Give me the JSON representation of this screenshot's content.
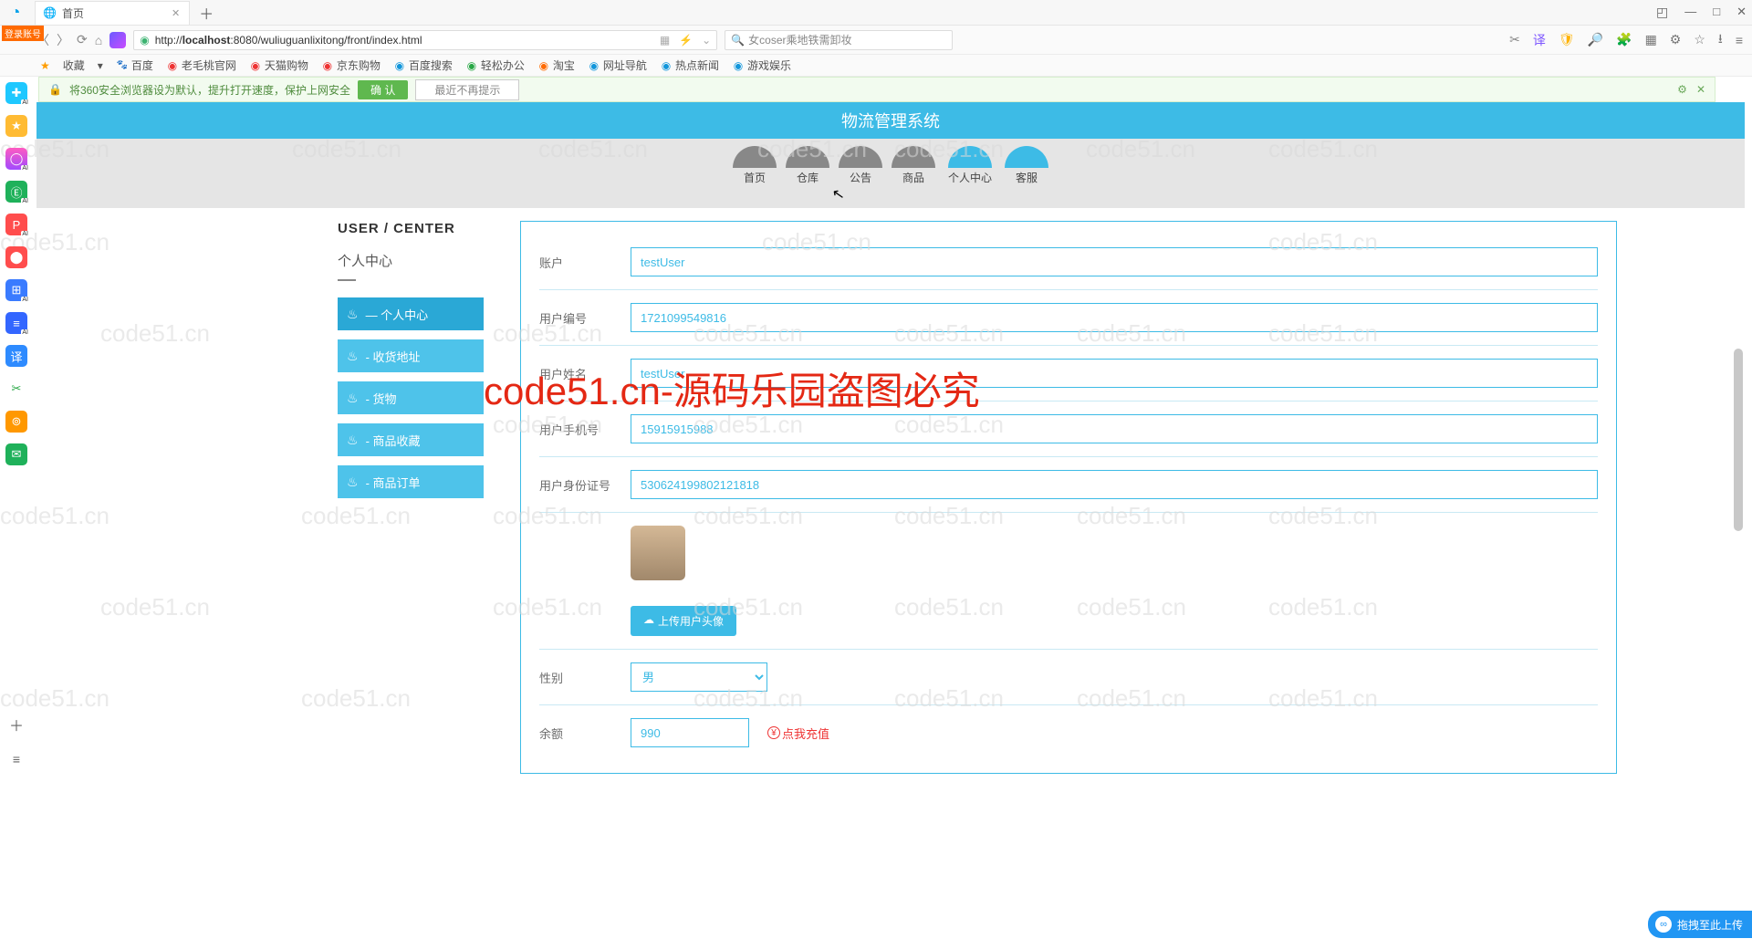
{
  "watermark": "code51.cn",
  "big_watermark": "code51.cn-源码乐园盗图必究",
  "titlebar": {
    "tab_title": "首页",
    "login_badge": "登录账号"
  },
  "winctrl": {
    "rect": "◰",
    "min": "—",
    "max": "□",
    "close": "✕"
  },
  "addr": {
    "url_prefix": "http://",
    "url_host": "localhost",
    "url_port": ":8080",
    "url_path": "/wuliuguanlixitong/front/index.html",
    "qr": "▦"
  },
  "search": {
    "placeholder": "女coser乘地铁需卸妆"
  },
  "bookmarks": {
    "fav": "收藏",
    "items": [
      "百度",
      "老毛桃官网",
      "天猫购物",
      "京东购物",
      "百度搜索",
      "轻松办公",
      "淘宝",
      "网址导航",
      "热点新闻",
      "游戏娱乐"
    ]
  },
  "infobar": {
    "text": "将360安全浏览器设为默认，提升打开速度，保护上网安全",
    "ok": "确 认",
    "no": "最近不再提示"
  },
  "page": {
    "header": "物流管理系统",
    "nav": [
      "首页",
      "仓库",
      "公告",
      "商品",
      "个人中心",
      "客服"
    ],
    "side_title": "USER / CENTER",
    "side_sub": "个人中心",
    "menu": [
      "— 个人中心",
      "- 收货地址",
      "- 货物",
      "- 商品收藏",
      "- 商品订单"
    ],
    "form": {
      "account_label": "账户",
      "account": "testUser",
      "userno_label": "用户编号",
      "userno": "1721099549816",
      "name_label": "用户姓名",
      "name": "testUser",
      "phone_label": "用户手机号",
      "phone": "15915915988",
      "idcard_label": "用户身份证号",
      "idcard": "530624199802121818",
      "upload": "上传用户头像",
      "gender_label": "性别",
      "gender": "男",
      "balance_label": "余额",
      "balance": "990",
      "recharge": "点我充值"
    }
  },
  "float": "拖拽至此上传"
}
